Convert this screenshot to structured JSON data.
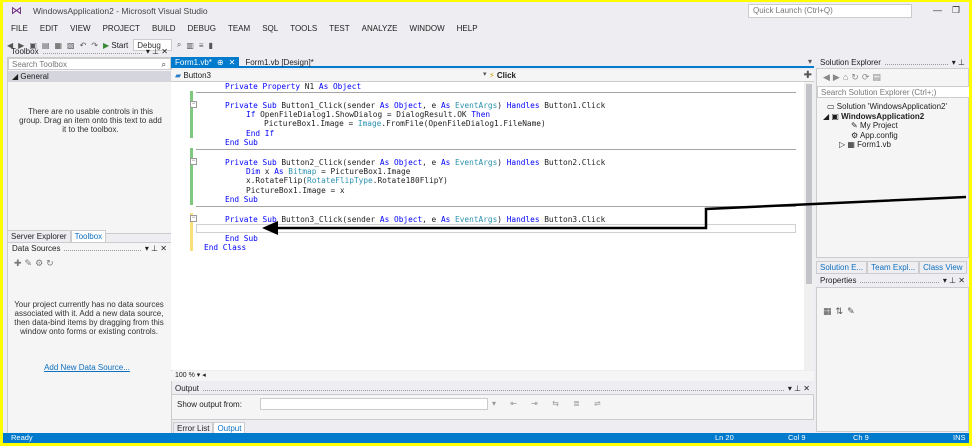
{
  "window": {
    "title": "WindowsApplication2 - Microsoft Visual Studio",
    "quick_launch": "Quick Launch (Ctrl+Q)"
  },
  "menu": [
    "FILE",
    "EDIT",
    "VIEW",
    "PROJECT",
    "BUILD",
    "DEBUG",
    "TEAM",
    "SQL",
    "TOOLS",
    "TEST",
    "ANALYZE",
    "WINDOW",
    "HELP"
  ],
  "toolbar": {
    "start_label": "Start",
    "config": "Debug"
  },
  "toolbox": {
    "title": "Toolbox",
    "search_placeholder": "Search Toolbox",
    "group": "General",
    "empty_msg": "There are no usable controls in this group. Drag an item onto this text to add it to the toolbox."
  },
  "left_tabs": [
    "Server Explorer",
    "Toolbox"
  ],
  "data_sources": {
    "title": "Data Sources",
    "msg": "Your project currently has no data sources associated with it. Add a new data source, then data-bind items by dragging from this window onto forms or existing controls.",
    "link": "Add New Data Source..."
  },
  "doc_tabs": {
    "active": "Form1.vb*",
    "other": "Form1.vb [Design]*"
  },
  "navbar": {
    "object": "Button3",
    "member": "Click"
  },
  "code": {
    "l1": "Private Property N1 As Object",
    "l2a": "Private Sub Button1_Click(sender As Object, e As EventArgs) Handles Button1.Click",
    "l3": "If OpenFileDialog1.ShowDialog = DialogResult.OK Then",
    "l4": "PictureBox1.Image = Image.FromFile(OpenFileDialog1.FileName)",
    "l5": "End If",
    "l6": "End Sub",
    "l7": "Private Sub Button2_Click(sender As Object, e As EventArgs) Handles Button2.Click",
    "l8": "Dim x As Bitmap = PictureBox1.Image",
    "l9": "x.RotateFlip(RotateFlipType.Rotate180FlipY)",
    "l10": "PictureBox1.Image = x",
    "l11": "End Sub",
    "l12": "Private Sub Button3_Click(sender As Object, e As EventArgs) Handles Button3.Click",
    "l13": "End Sub",
    "l14": "End Class"
  },
  "zoom": "100 %",
  "output": {
    "title": "Output",
    "show_from": "Show output from:"
  },
  "output_tabs": [
    "Error List",
    "Output"
  ],
  "solution_explorer": {
    "title": "Solution Explorer",
    "search": "Search Solution Explorer (Ctrl+;)",
    "solution": "Solution 'WindowsApplication2'",
    "project": "WindowsApplication2",
    "items": [
      "My Project",
      "App.config",
      "Form1.vb"
    ]
  },
  "se_tabs": [
    "Solution E...",
    "Team Expl...",
    "Class View"
  ],
  "properties": {
    "title": "Properties"
  },
  "status": {
    "ready": "Ready",
    "ln": "Ln 20",
    "col": "Col 9",
    "ch": "Ch 9",
    "ins": "INS"
  },
  "colors": {
    "accent": "#007acc",
    "arrow": "#000000",
    "frame": "#ffff00"
  }
}
